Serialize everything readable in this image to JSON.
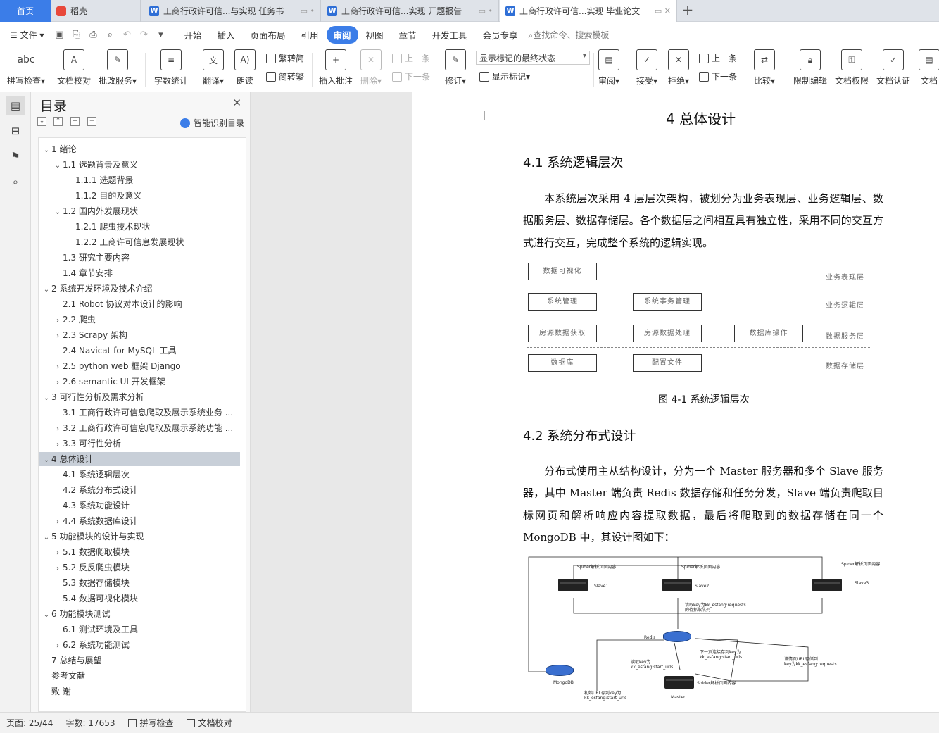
{
  "tabs": {
    "home": "首页",
    "docer": "稻壳",
    "doc1": "工商行政许可信...与实现 任务书",
    "doc2": "工商行政许可信...实现 开题报告",
    "doc3": "工商行政许可信...实现 毕业论文",
    "new_tab": "+"
  },
  "menu": {
    "file": "文件",
    "items": [
      "开始",
      "插入",
      "页面布局",
      "引用",
      "审阅",
      "视图",
      "章节",
      "开发工具",
      "会员专享"
    ],
    "search": "查找命令、搜索模板"
  },
  "ribbon": {
    "spell": "拼写检查",
    "spell_icon": "abc",
    "proof": "文档校对",
    "correction": "批改服务",
    "wordcount": "字数统计",
    "translate": "翻译",
    "read": "朗读",
    "trad": "繁转简",
    "simp": "简转繁",
    "insert_comment": "插入批注",
    "delete": "删除",
    "prev_comment": "上一条",
    "next_comment": "下一条",
    "revise": "修订",
    "markup_select": "显示标记的最终状态",
    "show_markup": "显示标记",
    "review": "审阅",
    "accept": "接受",
    "reject": "拒绝",
    "prev": "上一条",
    "next": "下一条",
    "compare": "比较",
    "restrict": "限制编辑",
    "permission": "文档权限",
    "auth": "文档认证",
    "doc_more": "文档"
  },
  "nav": {
    "title": "目录",
    "smart": "智能识别目录",
    "toc": [
      {
        "t": "1  绪论",
        "lv": 1,
        "exp": "v"
      },
      {
        "t": "1.1  选题背景及意义",
        "lv": 2,
        "exp": "v"
      },
      {
        "t": "1.1.1 选题背景",
        "lv": 3,
        "exp": ""
      },
      {
        "t": "1.1.2 目的及意义",
        "lv": 3,
        "exp": ""
      },
      {
        "t": "1.2  国内外发展现状",
        "lv": 2,
        "exp": "v"
      },
      {
        "t": "1.2.1  爬虫技术现状",
        "lv": 3,
        "exp": ""
      },
      {
        "t": "1.2.2  工商许可信息发展现状",
        "lv": 3,
        "exp": ""
      },
      {
        "t": "1.3  研究主要内容",
        "lv": 2,
        "exp": ""
      },
      {
        "t": "1.4  章节安排",
        "lv": 2,
        "exp": ""
      },
      {
        "t": "2  系统开发环境及技术介绍",
        "lv": 1,
        "exp": "v"
      },
      {
        "t": "2.1 Robot 协议对本设计的影响",
        "lv": 2,
        "exp": ""
      },
      {
        "t": "2.2  爬虫",
        "lv": 2,
        "exp": ">"
      },
      {
        "t": "2.3 Scrapy 架构",
        "lv": 2,
        "exp": ">"
      },
      {
        "t": "2.4 Navicat for MySQL 工具",
        "lv": 2,
        "exp": ""
      },
      {
        "t": "2.5 python web 框架 Django",
        "lv": 2,
        "exp": ">"
      },
      {
        "t": "2.6 semantic UI 开发框架",
        "lv": 2,
        "exp": ">"
      },
      {
        "t": "3  可行性分析及需求分析",
        "lv": 1,
        "exp": "v"
      },
      {
        "t": "3.1  工商行政许可信息爬取及展示系统业务 ...",
        "lv": 2,
        "exp": ""
      },
      {
        "t": "3.2  工商行政许可信息爬取及展示系统功能 ...",
        "lv": 2,
        "exp": ">"
      },
      {
        "t": "3.3  可行性分析",
        "lv": 2,
        "exp": ">"
      },
      {
        "t": "4  总体设计",
        "lv": 1,
        "exp": "v",
        "sel": true
      },
      {
        "t": "4.1  系统逻辑层次",
        "lv": 2,
        "exp": ""
      },
      {
        "t": "4.2  系统分布式设计",
        "lv": 2,
        "exp": ""
      },
      {
        "t": "4.3  系统功能设计",
        "lv": 2,
        "exp": ""
      },
      {
        "t": "4.4  系统数据库设计",
        "lv": 2,
        "exp": ">"
      },
      {
        "t": "5  功能模块的设计与实现",
        "lv": 1,
        "exp": "v"
      },
      {
        "t": "5.1  数据爬取模块",
        "lv": 2,
        "exp": ">"
      },
      {
        "t": "5.2  反反爬虫模块",
        "lv": 2,
        "exp": ">"
      },
      {
        "t": "5.3  数据存储模块",
        "lv": 2,
        "exp": ""
      },
      {
        "t": "5.4  数据可视化模块",
        "lv": 2,
        "exp": ""
      },
      {
        "t": "6  功能模块测试",
        "lv": 1,
        "exp": "v"
      },
      {
        "t": "6.1  测试环境及工具",
        "lv": 2,
        "exp": ""
      },
      {
        "t": "6.2  系统功能测试",
        "lv": 2,
        "exp": ">"
      },
      {
        "t": "7 总结与展望",
        "lv": 1,
        "exp": ""
      },
      {
        "t": "参考文献",
        "lv": 1,
        "exp": ""
      },
      {
        "t": "致    谢",
        "lv": 1,
        "exp": ""
      }
    ]
  },
  "doc": {
    "chapter": "4  总体设计",
    "sec1": "4.1  系统逻辑层次",
    "para1": "本系统层次采用 4 层层次架构，被划分为业务表现层、业务逻辑层、数据服务层、数据存储层。各个数据层之间相互具有独立性，采用不同的交互方式进行交互，完成整个系统的逻辑实现。",
    "fig1": {
      "b_vis": "数据可视化",
      "l_pres": "业务表现层",
      "b_sys": "系统管理",
      "b_aff": "系统事务管理",
      "l_logic": "业务逻辑层",
      "b_get": "房源数据获取",
      "b_proc": "房源数据处理",
      "b_dbop": "数据库操作",
      "l_svc": "数据服务层",
      "b_db": "数据库",
      "b_cfg": "配置文件",
      "l_store": "数据存储层"
    },
    "fig1_caption": "图 4-1  系统逻辑层次",
    "sec2": "4.2  系统分布式设计",
    "para2": "分布式使用主从结构设计，分为一个 Master 服务器和多个 Slave 服务器，其中 Master 端负责 Redis 数据存储和任务分发，Slave 端负责爬取目标网页和解析响应内容提取数据，最后将爬取到的数据存储在同一个 MongoDB 中，其设计图如下：",
    "fig2": {
      "sp1": "Spider解析页面内容",
      "sp2": "Spider解析页面内容",
      "sp3": "Spider解析页面内容",
      "s1": "Slave1",
      "s2": "Slave2",
      "s3": "Slave3",
      "req": "请取key为kk_esfang:requests\n的待抓取队列",
      "redis": "Redis",
      "next": "下一页连接存到key为\nkk_esfang:start_urls",
      "read": "读取key为\nkk_esfang:start_urls",
      "detail": "详情页URL存储到\nkey为kk_esfang:requests",
      "mongo": "MongoDB",
      "init": "初始URL存到key为\nkk_esfang:start_urls",
      "master": "Master",
      "spm": "Spider解析页面内容"
    }
  },
  "status": {
    "page": "页面: 25/44",
    "words": "字数: 17653",
    "spell": "拼写检查",
    "proof": "文档校对"
  }
}
